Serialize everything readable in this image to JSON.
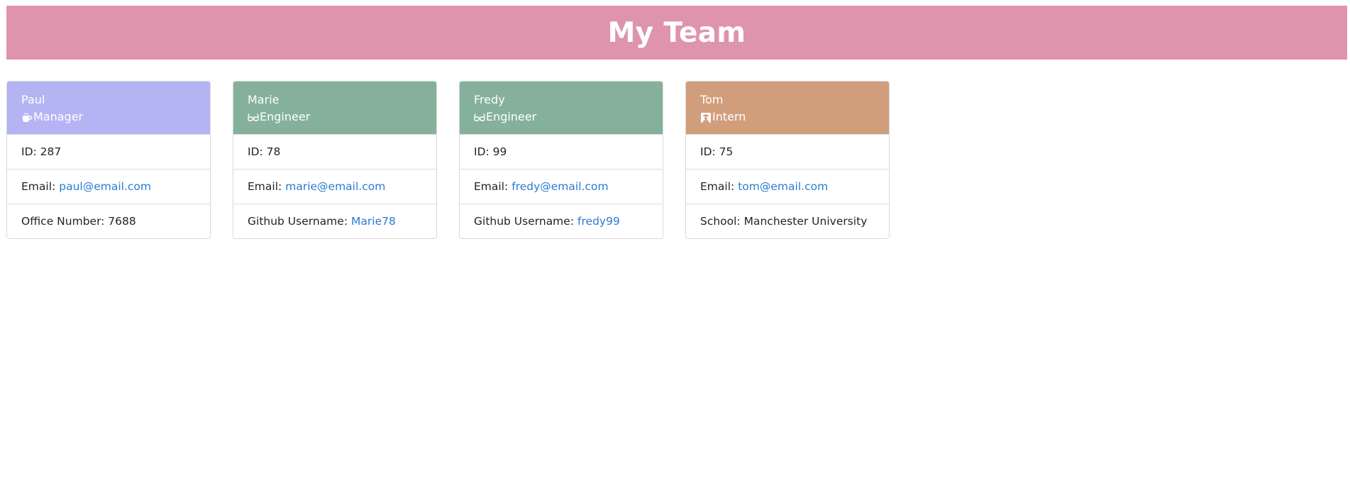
{
  "header": {
    "title": "My Team",
    "bg_color": "#df94ad"
  },
  "colors": {
    "link": "#2b7bd1",
    "manager": "#b4b4f4",
    "engineer": "#85b19c",
    "intern": "#d19e7c"
  },
  "cards": [
    {
      "name": "Paul",
      "role": "Manager",
      "icon": "mug-icon",
      "id_text": "ID: 287",
      "email_label": "Email:",
      "email": "paul@email.com",
      "extra_label": "Office Number: 7688",
      "extra_link": ""
    },
    {
      "name": "Marie",
      "role": "Engineer",
      "icon": "glasses-icon",
      "id_text": "ID: 78",
      "email_label": "Email:",
      "email": "marie@email.com",
      "extra_label": "Github Username:",
      "extra_link": "Marie78"
    },
    {
      "name": "Fredy",
      "role": "Engineer",
      "icon": "glasses-icon",
      "id_text": "ID: 99",
      "email_label": "Email:",
      "email": "fredy@email.com",
      "extra_label": "Github Username:",
      "extra_link": "fredy99"
    },
    {
      "name": "Tom",
      "role": "Intern",
      "icon": "graduate-icon",
      "id_text": "ID: 75",
      "email_label": "Email:",
      "email": "tom@email.com",
      "extra_label": "School: Manchester University",
      "extra_link": ""
    }
  ]
}
